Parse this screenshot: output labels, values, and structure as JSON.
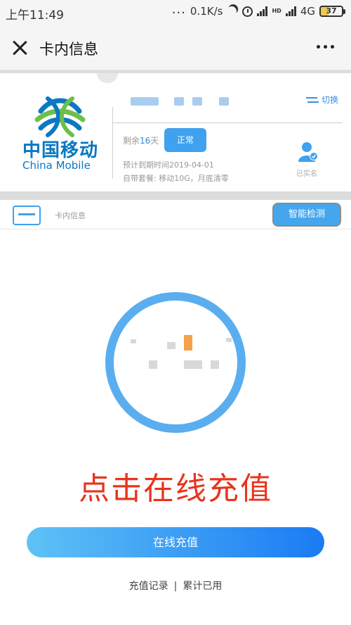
{
  "status_bar": {
    "time": "上午11:49",
    "dots": "...",
    "speed": "0.1K/s",
    "network": "4G",
    "hd": "HD",
    "battery": "37"
  },
  "title_bar": {
    "title": "卡内信息"
  },
  "card": {
    "logo_cn": "中国移动",
    "logo_en": "China Mobile",
    "switch_label": "切换",
    "remain_prefix": "剩余",
    "remain_days": "16",
    "remain_suffix": "天",
    "status": "正常",
    "expire_line": "预计到期时间2019-04-01",
    "package_line": "自带套餐:   移动10G，月底清零",
    "realname_label": "已实名"
  },
  "subrow": {
    "label": "卡内信息",
    "detect_button": "智能检测"
  },
  "promo_text": "点击在线充值",
  "recharge_button": "在线充值",
  "footer": {
    "records": "充值记录",
    "separator": "|",
    "usage": "累计已用"
  },
  "colors": {
    "accent_blue": "#3ea2ee",
    "brand_blue": "#0a78c2",
    "promo_red": "#e8341c"
  }
}
